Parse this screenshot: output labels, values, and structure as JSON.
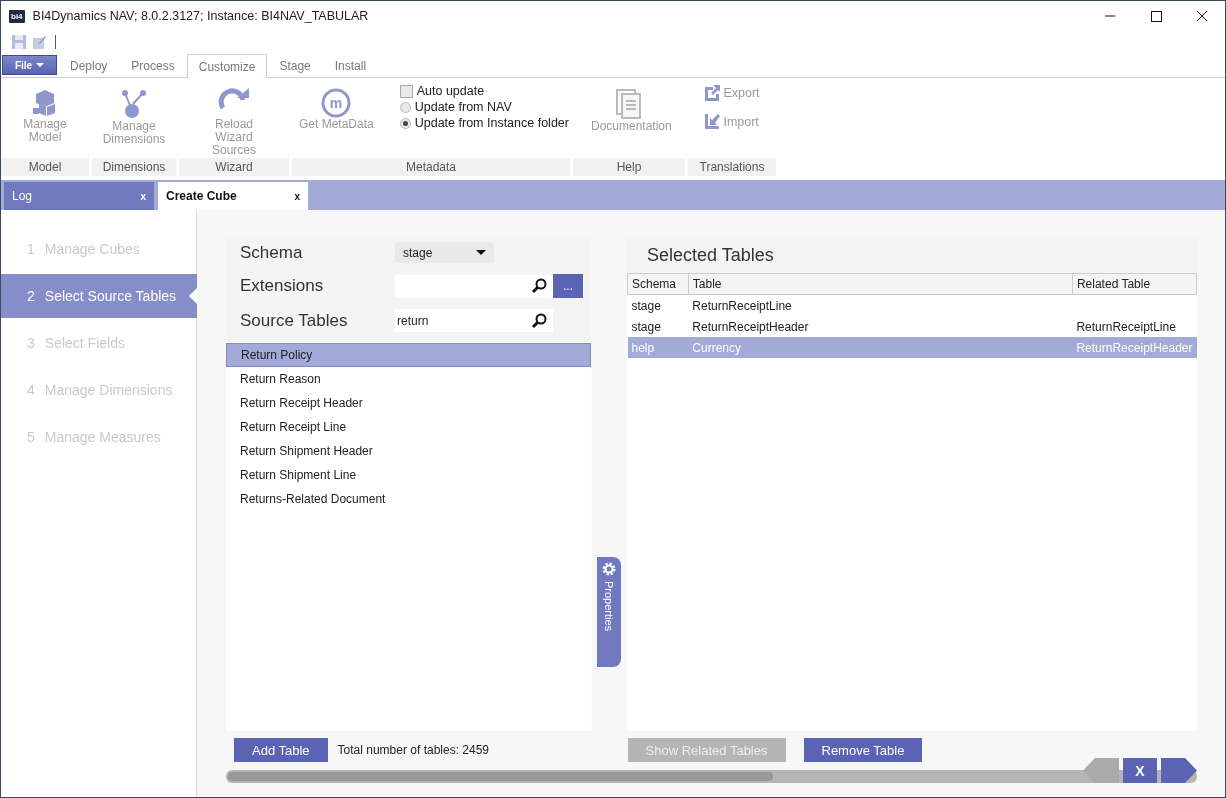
{
  "window": {
    "title": "BI4Dynamics NAV; 8.0.2.3127;  Instance: BI4NAV_TABULAR",
    "logo": "bi4"
  },
  "ribbon": {
    "file_button": "File",
    "tabs": [
      {
        "label": "Deploy",
        "selected": false
      },
      {
        "label": "Process",
        "selected": false
      },
      {
        "label": "Customize",
        "selected": true
      },
      {
        "label": "Stage",
        "selected": false
      },
      {
        "label": "Install",
        "selected": false
      }
    ],
    "groups": [
      {
        "label": "Model",
        "items": [
          {
            "kind": "button",
            "label": "Manage Model"
          }
        ]
      },
      {
        "label": "Dimensions",
        "items": [
          {
            "kind": "button",
            "label": "Manage Dimensions"
          }
        ]
      },
      {
        "label": "Wizard",
        "items": [
          {
            "kind": "button",
            "label": "Reload Wizard Sources"
          }
        ]
      },
      {
        "label": "Metadata",
        "items": [
          {
            "kind": "button",
            "label": "Get MetaData",
            "icon_text": "m"
          },
          {
            "kind": "checkbox",
            "label": "Auto update",
            "checked": false
          },
          {
            "kind": "radio",
            "label": "Update from NAV",
            "selected": false
          },
          {
            "kind": "radio",
            "label": "Update from Instance folder",
            "selected": true
          }
        ]
      },
      {
        "label": "Help",
        "items": [
          {
            "kind": "button",
            "label": "Documentation"
          }
        ]
      },
      {
        "label": "Translations",
        "items": [
          {
            "kind": "link",
            "label": "Export"
          },
          {
            "kind": "link",
            "label": "Import"
          }
        ]
      }
    ]
  },
  "doc_tabs": [
    {
      "label": "Log",
      "close": "x",
      "selected": false
    },
    {
      "label": "Create Cube",
      "close": "x",
      "selected": true
    }
  ],
  "wizard_steps": [
    {
      "number": "1",
      "label": "Manage Cubes",
      "selected": false
    },
    {
      "number": "2",
      "label": "Select Source Tables",
      "selected": true
    },
    {
      "number": "3",
      "label": "Select Fields",
      "selected": false
    },
    {
      "number": "4",
      "label": "Manage Dimensions",
      "selected": false
    },
    {
      "number": "5",
      "label": "Manage Measures",
      "selected": false
    }
  ],
  "source_panel": {
    "schema": {
      "label": "Schema",
      "value": "stage"
    },
    "extensions": {
      "label": "Extensions",
      "more_button": "..."
    },
    "source_tables": {
      "label": "Source Tables",
      "value": "return"
    },
    "list": [
      {
        "label": "Return Policy",
        "selected": true
      },
      {
        "label": "Return Reason",
        "selected": false
      },
      {
        "label": "Return Receipt Header",
        "selected": false
      },
      {
        "label": "Return Receipt Line",
        "selected": false
      },
      {
        "label": "Return Shipment Header",
        "selected": false
      },
      {
        "label": "Return Shipment Line",
        "selected": false
      },
      {
        "label": "Returns-Related Document",
        "selected": false
      }
    ],
    "add_button": "Add Table",
    "total": "Total number of tables: 2459"
  },
  "properties_tab": "Properties",
  "selected_tables": {
    "title": "Selected Tables",
    "columns": [
      "Schema",
      "Table",
      "Related Table"
    ],
    "rows": [
      {
        "cells": [
          "stage",
          "ReturnReceiptLine",
          ""
        ],
        "selected": false
      },
      {
        "cells": [
          "stage",
          "ReturnReceiptHeader",
          "ReturnReceiptLine"
        ],
        "selected": false
      },
      {
        "cells": [
          "help",
          "Currency",
          "ReturnReceiptHeader"
        ],
        "selected": true
      }
    ],
    "show_related_button": {
      "label": "Show Related Tables",
      "disabled": true
    },
    "remove_button": {
      "label": "Remove Table",
      "disabled": false
    }
  },
  "nav": {
    "cancel_button": "X"
  }
}
